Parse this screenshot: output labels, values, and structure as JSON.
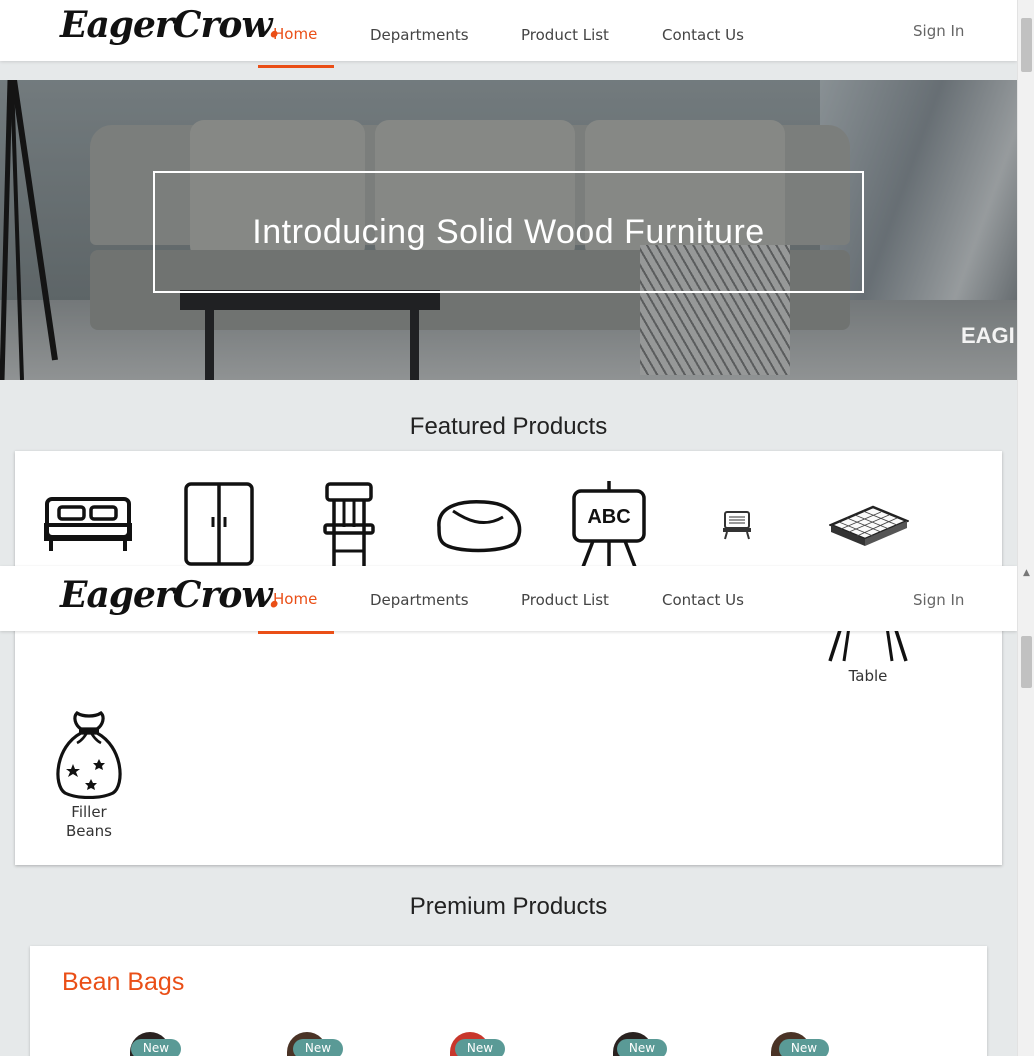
{
  "navbar": {
    "logo_text": "EagerCrow",
    "logo_dot": ".",
    "links": [
      "Home",
      "Departments",
      "Product List",
      "Contact Us"
    ],
    "active_link": "Home",
    "sign_in": "Sign In"
  },
  "hero": {
    "title": "Introducing Solid Wood Furniture",
    "watermark": "EAGI"
  },
  "featured": {
    "title": "Featured Products",
    "items": [
      {
        "label": "",
        "icon": "bed-icon"
      },
      {
        "label": "",
        "icon": "wardrobe-icon"
      },
      {
        "label": "",
        "icon": "bar-stool-icon"
      },
      {
        "label": "",
        "icon": "bean-bag-icon"
      },
      {
        "label": "",
        "icon": "easel-board-icon"
      },
      {
        "label": "",
        "icon": "laptop-stand-icon"
      },
      {
        "label": "",
        "icon": "mattress-icon"
      },
      {
        "label": "Table",
        "icon": "table-icon"
      },
      {
        "label": "Filler Beans",
        "icon": "filler-beans-bag-icon"
      }
    ],
    "abc_text": "ABC"
  },
  "premium": {
    "title": "Premium Products",
    "category": "Bean Bags",
    "badges": [
      "New",
      "New",
      "New",
      "New",
      "New"
    ]
  },
  "colors": {
    "accent": "#ea4f17",
    "badge": "#5a9a96",
    "background": "#e6e9ea"
  }
}
